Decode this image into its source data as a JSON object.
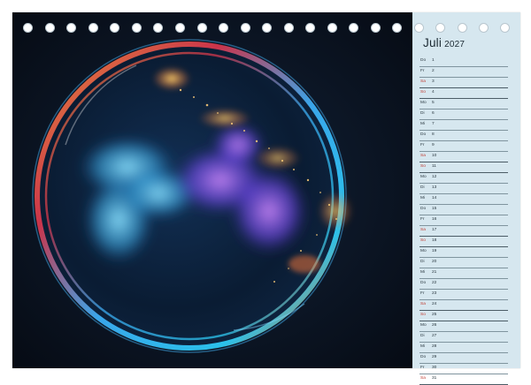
{
  "calendar": {
    "month": "Juli",
    "year": "2027",
    "days": [
      {
        "name": "Do",
        "num": "1",
        "weekend": false
      },
      {
        "name": "Fr",
        "num": "2",
        "weekend": false
      },
      {
        "name": "Sa",
        "num": "3",
        "weekend": true
      },
      {
        "name": "So",
        "num": "4",
        "weekend": true
      },
      {
        "name": "Mo",
        "num": "5",
        "weekend": false
      },
      {
        "name": "Di",
        "num": "6",
        "weekend": false
      },
      {
        "name": "Mi",
        "num": "7",
        "weekend": false
      },
      {
        "name": "Do",
        "num": "8",
        "weekend": false
      },
      {
        "name": "Fr",
        "num": "9",
        "weekend": false
      },
      {
        "name": "Sa",
        "num": "10",
        "weekend": true
      },
      {
        "name": "So",
        "num": "11",
        "weekend": true
      },
      {
        "name": "Mo",
        "num": "12",
        "weekend": false
      },
      {
        "name": "Di",
        "num": "13",
        "weekend": false
      },
      {
        "name": "Mi",
        "num": "14",
        "weekend": false
      },
      {
        "name": "Do",
        "num": "15",
        "weekend": false
      },
      {
        "name": "Fr",
        "num": "16",
        "weekend": false
      },
      {
        "name": "Sa",
        "num": "17",
        "weekend": true
      },
      {
        "name": "So",
        "num": "18",
        "weekend": true
      },
      {
        "name": "Mo",
        "num": "19",
        "weekend": false
      },
      {
        "name": "Di",
        "num": "20",
        "weekend": false
      },
      {
        "name": "Mi",
        "num": "21",
        "weekend": false
      },
      {
        "name": "Do",
        "num": "22",
        "weekend": false
      },
      {
        "name": "Fr",
        "num": "23",
        "weekend": false
      },
      {
        "name": "Sa",
        "num": "24",
        "weekend": true
      },
      {
        "name": "So",
        "num": "25",
        "weekend": true
      },
      {
        "name": "Mo",
        "num": "26",
        "weekend": false
      },
      {
        "name": "Di",
        "num": "27",
        "weekend": false
      },
      {
        "name": "Mi",
        "num": "28",
        "weekend": false
      },
      {
        "name": "Do",
        "num": "29",
        "weekend": false
      },
      {
        "name": "Fr",
        "num": "30",
        "weekend": false
      },
      {
        "name": "Sa",
        "num": "31",
        "weekend": true
      }
    ]
  },
  "colors": {
    "sidebar": "#d6e7ef",
    "photo_background": "#0b1320",
    "weekend_text": "#c03a2f"
  }
}
